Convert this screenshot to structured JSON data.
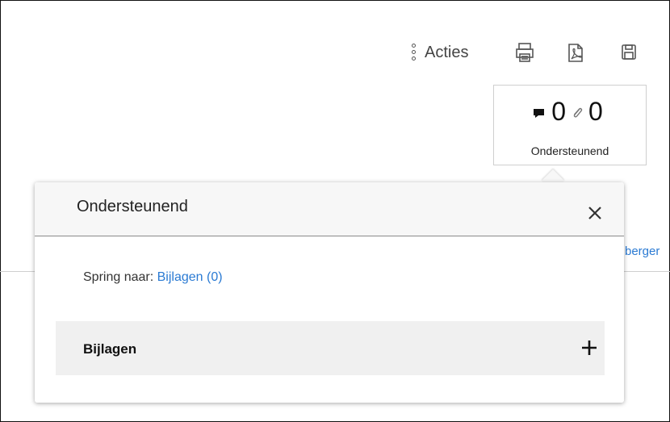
{
  "toolbar": {
    "actions_label": "Acties",
    "icons": [
      "more-vertical-icon",
      "print-icon",
      "pdf-icon",
      "save-icon"
    ]
  },
  "counter": {
    "comments_count": "0",
    "attachments_count": "0",
    "label": "Ondersteunend"
  },
  "background": {
    "partial_link": "berger"
  },
  "popover": {
    "title": "Ondersteunend",
    "jump_prefix": "Spring naar:",
    "jump_link": "Bijlagen (0)",
    "section_title": "Bijlagen"
  },
  "colors": {
    "link": "#2a7ad3",
    "header_bg": "#f7f7f7",
    "section_bg": "#f0f0f0"
  }
}
